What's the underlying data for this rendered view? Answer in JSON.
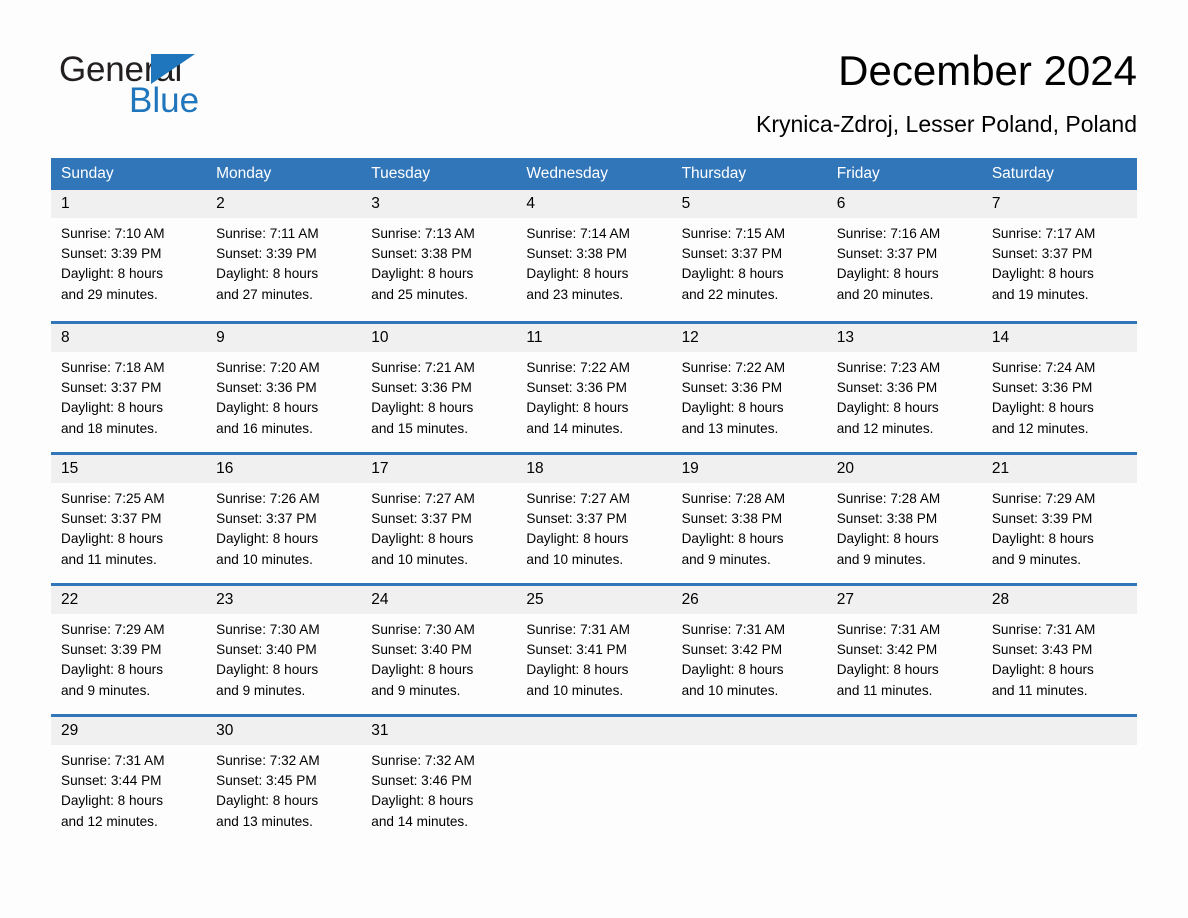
{
  "brand": {
    "name_part1": "General",
    "name_part2": "Blue",
    "accent_color": "#1f76bc"
  },
  "header": {
    "title": "December 2024",
    "location": "Krynica-Zdroj, Lesser Poland, Poland"
  },
  "calendar": {
    "header_bg": "#3176b9",
    "daynum_bg": "#f0f0f0",
    "weekday_headers": [
      "Sunday",
      "Monday",
      "Tuesday",
      "Wednesday",
      "Thursday",
      "Friday",
      "Saturday"
    ],
    "weeks": [
      [
        {
          "day": "1",
          "sunrise": "Sunrise: 7:10 AM",
          "sunset": "Sunset: 3:39 PM",
          "daylight_line1": "Daylight: 8 hours",
          "daylight_line2": "and 29 minutes."
        },
        {
          "day": "2",
          "sunrise": "Sunrise: 7:11 AM",
          "sunset": "Sunset: 3:39 PM",
          "daylight_line1": "Daylight: 8 hours",
          "daylight_line2": "and 27 minutes."
        },
        {
          "day": "3",
          "sunrise": "Sunrise: 7:13 AM",
          "sunset": "Sunset: 3:38 PM",
          "daylight_line1": "Daylight: 8 hours",
          "daylight_line2": "and 25 minutes."
        },
        {
          "day": "4",
          "sunrise": "Sunrise: 7:14 AM",
          "sunset": "Sunset: 3:38 PM",
          "daylight_line1": "Daylight: 8 hours",
          "daylight_line2": "and 23 minutes."
        },
        {
          "day": "5",
          "sunrise": "Sunrise: 7:15 AM",
          "sunset": "Sunset: 3:37 PM",
          "daylight_line1": "Daylight: 8 hours",
          "daylight_line2": "and 22 minutes."
        },
        {
          "day": "6",
          "sunrise": "Sunrise: 7:16 AM",
          "sunset": "Sunset: 3:37 PM",
          "daylight_line1": "Daylight: 8 hours",
          "daylight_line2": "and 20 minutes."
        },
        {
          "day": "7",
          "sunrise": "Sunrise: 7:17 AM",
          "sunset": "Sunset: 3:37 PM",
          "daylight_line1": "Daylight: 8 hours",
          "daylight_line2": "and 19 minutes."
        }
      ],
      [
        {
          "day": "8",
          "sunrise": "Sunrise: 7:18 AM",
          "sunset": "Sunset: 3:37 PM",
          "daylight_line1": "Daylight: 8 hours",
          "daylight_line2": "and 18 minutes."
        },
        {
          "day": "9",
          "sunrise": "Sunrise: 7:20 AM",
          "sunset": "Sunset: 3:36 PM",
          "daylight_line1": "Daylight: 8 hours",
          "daylight_line2": "and 16 minutes."
        },
        {
          "day": "10",
          "sunrise": "Sunrise: 7:21 AM",
          "sunset": "Sunset: 3:36 PM",
          "daylight_line1": "Daylight: 8 hours",
          "daylight_line2": "and 15 minutes."
        },
        {
          "day": "11",
          "sunrise": "Sunrise: 7:22 AM",
          "sunset": "Sunset: 3:36 PM",
          "daylight_line1": "Daylight: 8 hours",
          "daylight_line2": "and 14 minutes."
        },
        {
          "day": "12",
          "sunrise": "Sunrise: 7:22 AM",
          "sunset": "Sunset: 3:36 PM",
          "daylight_line1": "Daylight: 8 hours",
          "daylight_line2": "and 13 minutes."
        },
        {
          "day": "13",
          "sunrise": "Sunrise: 7:23 AM",
          "sunset": "Sunset: 3:36 PM",
          "daylight_line1": "Daylight: 8 hours",
          "daylight_line2": "and 12 minutes."
        },
        {
          "day": "14",
          "sunrise": "Sunrise: 7:24 AM",
          "sunset": "Sunset: 3:36 PM",
          "daylight_line1": "Daylight: 8 hours",
          "daylight_line2": "and 12 minutes."
        }
      ],
      [
        {
          "day": "15",
          "sunrise": "Sunrise: 7:25 AM",
          "sunset": "Sunset: 3:37 PM",
          "daylight_line1": "Daylight: 8 hours",
          "daylight_line2": "and 11 minutes."
        },
        {
          "day": "16",
          "sunrise": "Sunrise: 7:26 AM",
          "sunset": "Sunset: 3:37 PM",
          "daylight_line1": "Daylight: 8 hours",
          "daylight_line2": "and 10 minutes."
        },
        {
          "day": "17",
          "sunrise": "Sunrise: 7:27 AM",
          "sunset": "Sunset: 3:37 PM",
          "daylight_line1": "Daylight: 8 hours",
          "daylight_line2": "and 10 minutes."
        },
        {
          "day": "18",
          "sunrise": "Sunrise: 7:27 AM",
          "sunset": "Sunset: 3:37 PM",
          "daylight_line1": "Daylight: 8 hours",
          "daylight_line2": "and 10 minutes."
        },
        {
          "day": "19",
          "sunrise": "Sunrise: 7:28 AM",
          "sunset": "Sunset: 3:38 PM",
          "daylight_line1": "Daylight: 8 hours",
          "daylight_line2": "and 9 minutes."
        },
        {
          "day": "20",
          "sunrise": "Sunrise: 7:28 AM",
          "sunset": "Sunset: 3:38 PM",
          "daylight_line1": "Daylight: 8 hours",
          "daylight_line2": "and 9 minutes."
        },
        {
          "day": "21",
          "sunrise": "Sunrise: 7:29 AM",
          "sunset": "Sunset: 3:39 PM",
          "daylight_line1": "Daylight: 8 hours",
          "daylight_line2": "and 9 minutes."
        }
      ],
      [
        {
          "day": "22",
          "sunrise": "Sunrise: 7:29 AM",
          "sunset": "Sunset: 3:39 PM",
          "daylight_line1": "Daylight: 8 hours",
          "daylight_line2": "and 9 minutes."
        },
        {
          "day": "23",
          "sunrise": "Sunrise: 7:30 AM",
          "sunset": "Sunset: 3:40 PM",
          "daylight_line1": "Daylight: 8 hours",
          "daylight_line2": "and 9 minutes."
        },
        {
          "day": "24",
          "sunrise": "Sunrise: 7:30 AM",
          "sunset": "Sunset: 3:40 PM",
          "daylight_line1": "Daylight: 8 hours",
          "daylight_line2": "and 9 minutes."
        },
        {
          "day": "25",
          "sunrise": "Sunrise: 7:31 AM",
          "sunset": "Sunset: 3:41 PM",
          "daylight_line1": "Daylight: 8 hours",
          "daylight_line2": "and 10 minutes."
        },
        {
          "day": "26",
          "sunrise": "Sunrise: 7:31 AM",
          "sunset": "Sunset: 3:42 PM",
          "daylight_line1": "Daylight: 8 hours",
          "daylight_line2": "and 10 minutes."
        },
        {
          "day": "27",
          "sunrise": "Sunrise: 7:31 AM",
          "sunset": "Sunset: 3:42 PM",
          "daylight_line1": "Daylight: 8 hours",
          "daylight_line2": "and 11 minutes."
        },
        {
          "day": "28",
          "sunrise": "Sunrise: 7:31 AM",
          "sunset": "Sunset: 3:43 PM",
          "daylight_line1": "Daylight: 8 hours",
          "daylight_line2": "and 11 minutes."
        }
      ],
      [
        {
          "day": "29",
          "sunrise": "Sunrise: 7:31 AM",
          "sunset": "Sunset: 3:44 PM",
          "daylight_line1": "Daylight: 8 hours",
          "daylight_line2": "and 12 minutes."
        },
        {
          "day": "30",
          "sunrise": "Sunrise: 7:32 AM",
          "sunset": "Sunset: 3:45 PM",
          "daylight_line1": "Daylight: 8 hours",
          "daylight_line2": "and 13 minutes."
        },
        {
          "day": "31",
          "sunrise": "Sunrise: 7:32 AM",
          "sunset": "Sunset: 3:46 PM",
          "daylight_line1": "Daylight: 8 hours",
          "daylight_line2": "and 14 minutes."
        },
        {
          "day": "",
          "sunrise": "",
          "sunset": "",
          "daylight_line1": "",
          "daylight_line2": ""
        },
        {
          "day": "",
          "sunrise": "",
          "sunset": "",
          "daylight_line1": "",
          "daylight_line2": ""
        },
        {
          "day": "",
          "sunrise": "",
          "sunset": "",
          "daylight_line1": "",
          "daylight_line2": ""
        },
        {
          "day": "",
          "sunrise": "",
          "sunset": "",
          "daylight_line1": "",
          "daylight_line2": ""
        }
      ]
    ]
  }
}
